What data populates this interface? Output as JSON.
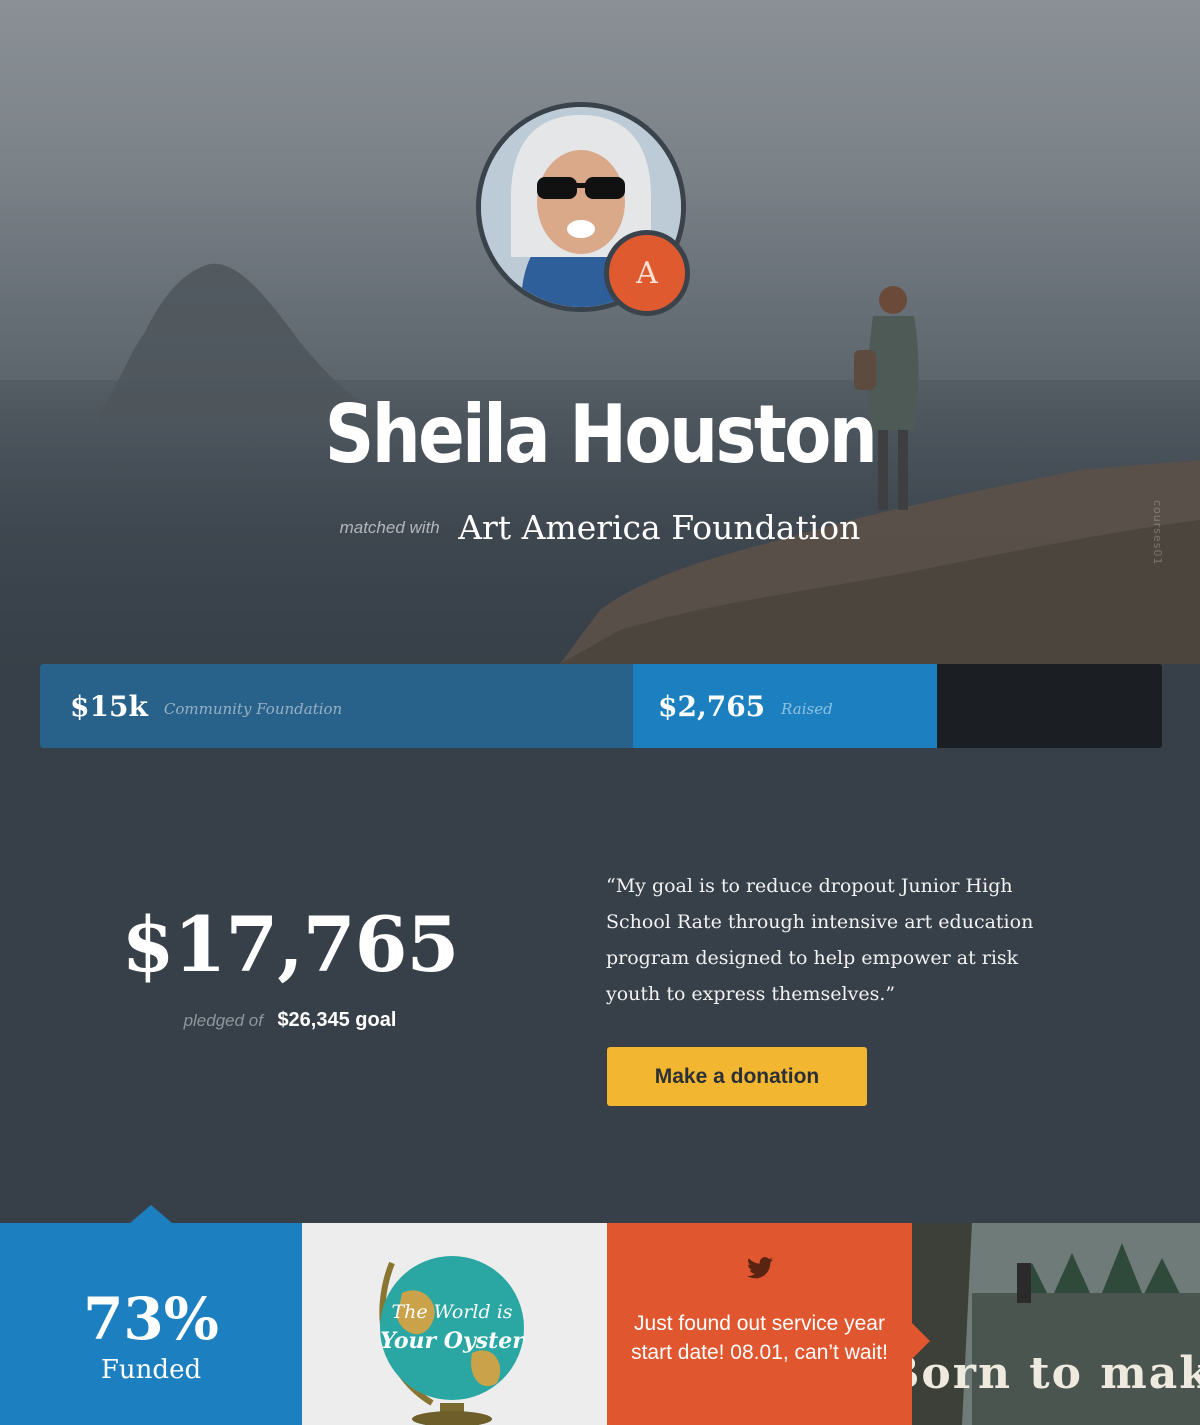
{
  "profile": {
    "name": "Sheila Houston",
    "matched_with_label": "matched with",
    "organization": "Art America Foundation",
    "badge_letter": "A"
  },
  "hero": {
    "watermark": "courses01"
  },
  "progress": {
    "community": {
      "amount": "$15k",
      "label": "Community Foundation"
    },
    "raised": {
      "amount": "$2,765",
      "label": "Raised"
    }
  },
  "pledge": {
    "total": "$17,765",
    "pledged_of_label": "pledged of",
    "goal": "$26,345 goal"
  },
  "quote": {
    "text": "“My goal is to reduce dropout Junior High School Rate through intensive art education program designed to help empower at risk youth to express themselves.”"
  },
  "donate_button": {
    "label": "Make a donation",
    "color": "#f2b631"
  },
  "tiles": {
    "funded": {
      "percent": "73%",
      "label": "Funded",
      "color": "#1b7fc0"
    },
    "globe": {
      "text_line1": "The World is",
      "text_line2": "Your Oyster"
    },
    "tweet": {
      "icon": "twitter-icon",
      "text": "Just found out service year start date! 08.01, can’t wait!",
      "color": "#e0562f"
    },
    "photo": {
      "text": "Born to make"
    }
  }
}
